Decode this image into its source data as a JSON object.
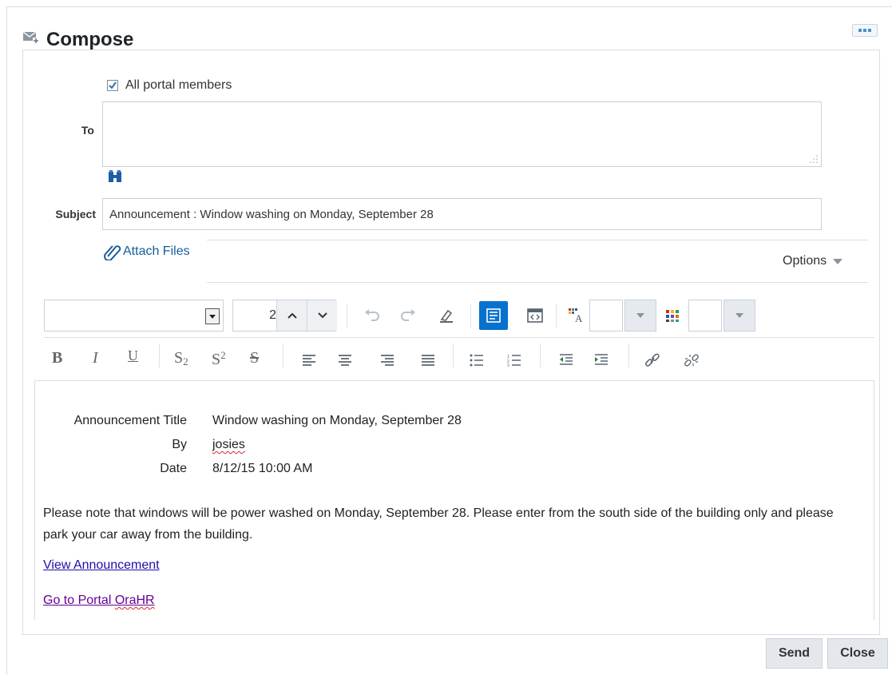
{
  "header": {
    "title": "Compose"
  },
  "recipients": {
    "all_members_label": "All portal members",
    "all_members_checked": true,
    "to_label": "To",
    "to_value": ""
  },
  "subject": {
    "label": "Subject",
    "value": "Announcement : Window washing on Monday, September 28"
  },
  "attach": {
    "label": "Attach Files"
  },
  "options": {
    "label": "Options"
  },
  "toolbar": {
    "font_name": "",
    "font_size": "2"
  },
  "message": {
    "meta": [
      {
        "key": "Announcement Title",
        "value": "Window washing on Monday, September 28"
      },
      {
        "key": "By",
        "value": "josies"
      },
      {
        "key": "Date",
        "value": "8/12/15 10:00 AM"
      }
    ],
    "body": "Please note that windows will be power washed on Monday, September 28. Please enter from the south side of the building only and please park your car away from the building.",
    "links": [
      {
        "text": "View Announcement"
      },
      {
        "text_prefix": "Go to Portal ",
        "text_misspelled": "OraHR"
      }
    ]
  },
  "footer": {
    "send_label": "Send",
    "close_label": "Close"
  },
  "colors": {
    "accent": "#0572ce",
    "link": "#1a0dab",
    "visited_link": "#660099"
  }
}
